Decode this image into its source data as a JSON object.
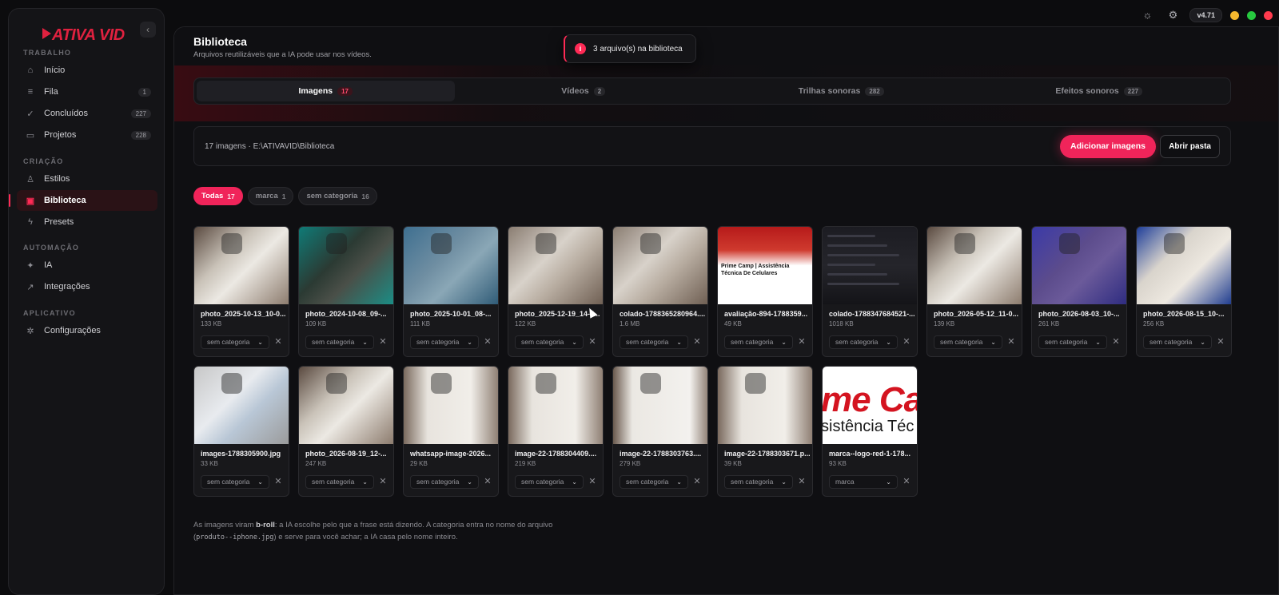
{
  "app": {
    "logo_text": "ATIVA VID",
    "version": "v4.71",
    "window_controls": {
      "minimize_color": "#f5b82e",
      "maximize_color": "#27c93f",
      "close_color": "#ff3b4e"
    },
    "accent": "#f0245a"
  },
  "sidebar": {
    "sections": [
      {
        "label": "TRABALHO",
        "items": [
          {
            "label": "Início",
            "icon": "home-icon",
            "count": ""
          },
          {
            "label": "Fila",
            "icon": "list-icon",
            "count": "1"
          },
          {
            "label": "Concluídos",
            "icon": "check-circle-icon",
            "count": "227"
          },
          {
            "label": "Projetos",
            "icon": "folder-icon",
            "count": "228"
          }
        ]
      },
      {
        "label": "CRIAÇÃO",
        "items": [
          {
            "label": "Estilos",
            "icon": "user-icon",
            "count": ""
          },
          {
            "label": "Biblioteca",
            "icon": "library-icon",
            "count": "",
            "active": true
          },
          {
            "label": "Presets",
            "icon": "bolt-icon",
            "count": ""
          }
        ]
      },
      {
        "label": "AUTOMAÇÃO",
        "items": [
          {
            "label": "IA",
            "icon": "sparkle-icon",
            "count": ""
          },
          {
            "label": "Integrações",
            "icon": "external-link-icon",
            "count": ""
          }
        ]
      },
      {
        "label": "APLICATIVO",
        "items": [
          {
            "label": "Configurações",
            "icon": "gear-icon",
            "count": ""
          }
        ]
      }
    ]
  },
  "header": {
    "title": "Biblioteca",
    "subtitle": "Arquivos reutilizáveis que a IA pode usar nos vídeos."
  },
  "toast": {
    "icon": "info-icon",
    "text": "3 arquivo(s) na biblioteca"
  },
  "tabs": [
    {
      "label": "Imagens",
      "count": "17",
      "active": true
    },
    {
      "label": "Vídeos",
      "count": "2"
    },
    {
      "label": "Trilhas sonoras",
      "count": "282"
    },
    {
      "label": "Efeitos sonoros",
      "count": "227"
    }
  ],
  "toolbar": {
    "info": "17 imagens · E:\\ATIVAVID\\Biblioteca",
    "add_label": "Adicionar imagens",
    "open_label": "Abrir pasta"
  },
  "filters": [
    {
      "label": "Todas",
      "count": "17",
      "active": true
    },
    {
      "label": "marca",
      "count": "1"
    },
    {
      "label": "sem categoria",
      "count": "16"
    }
  ],
  "cards": [
    {
      "name": "photo_2025-10-13_10-0...",
      "size": "133 KB",
      "category": "sem categoria",
      "thumb": "white-phone"
    },
    {
      "name": "photo_2024-10-08_09-...",
      "size": "109 KB",
      "category": "sem categoria",
      "thumb": "green-phone"
    },
    {
      "name": "photo_2025-10-01_08-...",
      "size": "111 KB",
      "category": "sem categoria",
      "thumb": "blue-phone"
    },
    {
      "name": "photo_2025-12-19_14-5...",
      "size": "122 KB",
      "category": "sem categoria",
      "thumb": "cracked-phone"
    },
    {
      "name": "colado-1788365280964....",
      "size": "1.6 MB",
      "category": "sem categoria",
      "thumb": "cracked-phone"
    },
    {
      "name": "avaliação-894-1788359...",
      "size": "49 KB",
      "category": "sem categoria",
      "thumb": "review",
      "title": "Prime Camp | Assistência Técnica De Celulares"
    },
    {
      "name": "colado-1788347684521-...",
      "size": "1018 KB",
      "category": "sem categoria",
      "thumb": "screenshot"
    },
    {
      "name": "photo_2026-05-12_11-0...",
      "size": "139 KB",
      "category": "sem categoria",
      "thumb": "white-phone"
    },
    {
      "name": "photo_2026-08-03_10-...",
      "size": "261 KB",
      "category": "sem categoria",
      "thumb": "purple-phone"
    },
    {
      "name": "photo_2026-08-15_10-...",
      "size": "256 KB",
      "category": "sem categoria",
      "thumb": "white-phone-blue"
    },
    {
      "name": "images-1788305900.jpg",
      "size": "33 KB",
      "category": "sem categoria",
      "thumb": "magsafe"
    },
    {
      "name": "photo_2026-08-19_12-...",
      "size": "247 KB",
      "category": "sem categoria",
      "thumb": "white-phone"
    },
    {
      "name": "whatsapp-image-2026...",
      "size": "29 KB",
      "category": "sem categoria",
      "thumb": "white-back"
    },
    {
      "name": "image-22-1788304409....",
      "size": "219 KB",
      "category": "sem categoria",
      "thumb": "white-back"
    },
    {
      "name": "image-22-1788303763....",
      "size": "279 KB",
      "category": "sem categoria",
      "thumb": "white-plain"
    },
    {
      "name": "image-22-1788303671.p...",
      "size": "39 KB",
      "category": "sem categoria",
      "thumb": "white-back"
    },
    {
      "name": "marca--logo-red-1-178...",
      "size": "93 KB",
      "category": "marca",
      "thumb": "logo",
      "logo_line1": "me Ca",
      "logo_line2": "sistência Téc"
    }
  ],
  "footnote": {
    "p1": "As imagens viram ",
    "b1": "b-roll",
    "p2": ": a IA escolhe pelo que a frase está dizendo. A categoria entra no nome do arquivo (",
    "code1": "produto--iphone.jpg",
    "p3": ") e serve para você achar; a IA casa pelo nome inteiro."
  }
}
